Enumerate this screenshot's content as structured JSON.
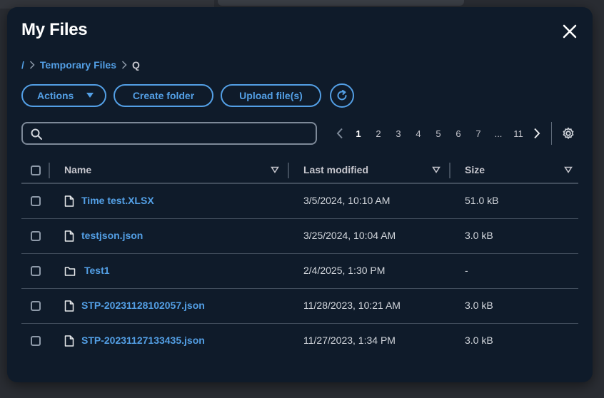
{
  "modal": {
    "title": "My Files",
    "close_icon": "close-icon"
  },
  "breadcrumb": {
    "items": [
      "/",
      "Temporary Files",
      "Q"
    ]
  },
  "toolbar": {
    "actions_label": "Actions",
    "create_folder_label": "Create folder",
    "upload_label": "Upload file(s)",
    "refresh_icon": "refresh-icon"
  },
  "search": {
    "value": "",
    "placeholder": ""
  },
  "pagination": {
    "pages": [
      "1",
      "2",
      "3",
      "4",
      "5",
      "6",
      "7",
      "...",
      "11"
    ],
    "current": "1"
  },
  "table": {
    "columns": [
      "Name",
      "Last modified",
      "Size"
    ],
    "rows": [
      {
        "name": "Time test.XLSX",
        "modified": "3/5/2024, 10:10 AM",
        "size": "51.0 kB",
        "type": "file"
      },
      {
        "name": "testjson.json",
        "modified": "3/25/2024, 10:04 AM",
        "size": "3.0 kB",
        "type": "file"
      },
      {
        "name": "Test1",
        "modified": "2/4/2025, 1:30 PM",
        "size": "-",
        "type": "folder"
      },
      {
        "name": "STP-20231128102057.json",
        "modified": "11/28/2023, 10:21 AM",
        "size": "3.0 kB",
        "type": "file"
      },
      {
        "name": "STP-20231127133435.json",
        "modified": "11/27/2023, 1:34 PM",
        "size": "3.0 kB",
        "type": "file"
      }
    ]
  },
  "colors": {
    "background": "#0f1b2a",
    "accent": "#539fe5",
    "text": "#d1d5db",
    "border": "#414d5c"
  }
}
